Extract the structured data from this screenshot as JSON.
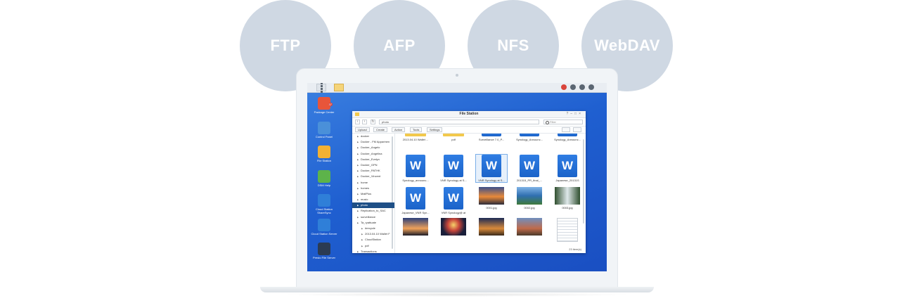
{
  "protocols": [
    "FTP",
    "AFP",
    "NFS",
    "WebDAV"
  ],
  "desktop_icons": [
    {
      "label": "Package Center",
      "badge": "37",
      "color": "#e8553a"
    },
    {
      "label": "Control Panel",
      "color": "#4a90d9"
    },
    {
      "label": "File Station",
      "color": "#f2b134"
    },
    {
      "label": "DSM Help",
      "color": "#5db34a"
    },
    {
      "label": "Cloud Station ShareSync",
      "color": "#2f7fd8"
    },
    {
      "label": "Cloud Station Server",
      "color": "#2f7fd8"
    },
    {
      "label": "Presto File Server",
      "color": "#2b3b52"
    }
  ],
  "file_station": {
    "title": "File Station",
    "path": "photo",
    "filter_placeholder": "Filter",
    "toolbar": [
      "Upload",
      "Create",
      "Action",
      "Tools",
      "Settings"
    ],
    "tree": [
      {
        "label": "docker",
        "level": 0
      },
      {
        "label": "Docker - FM Apparinen",
        "level": 0
      },
      {
        "label": "Docker_Angelo",
        "level": 0
      },
      {
        "label": "Docker_Angelina",
        "level": 0
      },
      {
        "label": "Docker_Evelyn",
        "level": 0
      },
      {
        "label": "Docker_GPN",
        "level": 0
      },
      {
        "label": "Docker_PATHK",
        "level": 0
      },
      {
        "label": "Docker_Vincent",
        "level": 0
      },
      {
        "label": "home",
        "level": 0
      },
      {
        "label": "homes",
        "level": 0
      },
      {
        "label": "MailPlus",
        "level": 0
      },
      {
        "label": "music",
        "level": 0
      },
      {
        "label": "photo",
        "level": 0,
        "selected": true
      },
      {
        "label": "Replication_to_SAC",
        "level": 0
      },
      {
        "label": "surveillance",
        "level": 0
      },
      {
        "label": "Ta_ryattuate",
        "level": 0
      },
      {
        "label": "#recycle",
        "level": 1
      },
      {
        "label": "2013.04.10 Wallet F",
        "level": 1
      },
      {
        "label": "CloudStation",
        "level": 1
      },
      {
        "label": "pdf",
        "level": 1
      },
      {
        "label": "Transactions",
        "level": 0
      }
    ],
    "files": [
      {
        "name": "2013.04.10 Wallet ...",
        "kind": "folder"
      },
      {
        "name": "pdf",
        "kind": "folder"
      },
      {
        "name": "Surveillance 7.0_P...",
        "kind": "word-flat"
      },
      {
        "name": "Synology_Announc...",
        "kind": "word-flat"
      },
      {
        "name": "Synology_Announc...",
        "kind": "word-flat"
      },
      {
        "name": "Synology_announc...",
        "kind": "word"
      },
      {
        "name": "VNR Synology at S...",
        "kind": "word"
      },
      {
        "name": "VNR Synology at S...",
        "kind": "word",
        "selected": true
      },
      {
        "name": "201315_PR_final_...",
        "kind": "word"
      },
      {
        "name": "Japanese_20131S",
        "kind": "word"
      },
      {
        "name": "Japanese_VNR Syn...",
        "kind": "word"
      },
      {
        "name": "VNR Synology@ at",
        "kind": "word"
      },
      {
        "name": "0001.jpg",
        "kind": "photo",
        "photo": "sunset"
      },
      {
        "name": "0002.jpg",
        "kind": "photo",
        "photo": "lake"
      },
      {
        "name": "0003.jpg",
        "kind": "photo",
        "photo": "waterfall"
      },
      {
        "name": "",
        "kind": "photo",
        "photo": "dusk"
      },
      {
        "name": "",
        "kind": "photo",
        "photo": "fireworks"
      },
      {
        "name": "",
        "kind": "photo",
        "photo": "temple"
      },
      {
        "name": "",
        "kind": "photo",
        "photo": "palace"
      },
      {
        "name": "",
        "kind": "doc"
      }
    ],
    "item_count": "23 item(s)"
  },
  "colors": {
    "accent": "#1e4f86",
    "circle": "#cfd8e3",
    "desktop": "#1f5fd0"
  }
}
